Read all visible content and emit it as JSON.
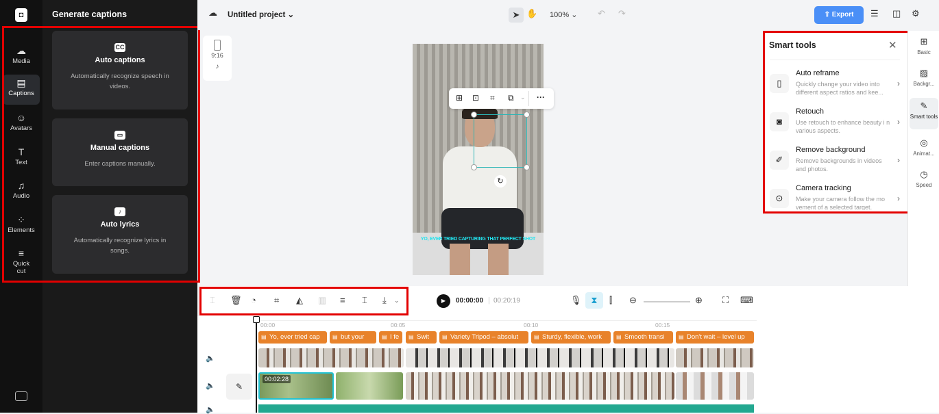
{
  "rail": {
    "items": [
      {
        "id": "media",
        "label": "Media",
        "icon": "☁"
      },
      {
        "id": "captions",
        "label": "Captions",
        "icon": "▤"
      },
      {
        "id": "avatars",
        "label": "Avatars",
        "icon": "☺"
      },
      {
        "id": "text",
        "label": "Text",
        "icon": "T"
      },
      {
        "id": "audio",
        "label": "Audio",
        "icon": "♫"
      },
      {
        "id": "elements",
        "label": "Elements",
        "icon": "⁘"
      },
      {
        "id": "quickcut",
        "label": "Quick cut",
        "icon": "≡"
      }
    ]
  },
  "panel": {
    "title": "Generate captions",
    "cards": [
      {
        "title": "Auto captions",
        "desc": "Automatically recognize speech in videos.",
        "icon": "CC"
      },
      {
        "title": "Manual captions",
        "desc": "Enter captions manually.",
        "icon": "▭"
      },
      {
        "title": "Auto lyrics",
        "desc": "Automatically recognize lyrics in songs.",
        "icon": "♪"
      }
    ]
  },
  "topbar": {
    "project": "Untitled project",
    "zoom": "100%",
    "export": "Export"
  },
  "aspect": {
    "ratio": "9:16"
  },
  "video": {
    "subtitle": "YO, EVER TRIED CAPTURING THAT PERFECT SHOT"
  },
  "smart": {
    "title": "Smart tools",
    "tools": [
      {
        "title": "Auto reframe",
        "desc": "Quickly change your video into different aspect ratios and kee..."
      },
      {
        "title": "Retouch",
        "desc": "Use retouch to enhance beauty i n various aspects."
      },
      {
        "title": "Remove background",
        "desc": "Remove backgrounds in videos and photos."
      },
      {
        "title": "Camera tracking",
        "desc": "Make your camera follow the mo vement of a selected target."
      }
    ]
  },
  "sidebar": {
    "items": [
      {
        "label": "Basic",
        "icon": "⊞"
      },
      {
        "label": "Backgr...",
        "icon": "▨"
      },
      {
        "label": "Smart tools",
        "icon": "✎"
      },
      {
        "label": "Animat...",
        "icon": "◎"
      },
      {
        "label": "Speed",
        "icon": "◷"
      }
    ]
  },
  "player": {
    "current": "00:00:00",
    "total": "00:20:19"
  },
  "timeline": {
    "ticks": [
      "00:00",
      "00:05",
      "00:10",
      "00:15"
    ],
    "captions": [
      "Yo, ever tried cap",
      "but your",
      "I fe",
      "Swit",
      "Variety Tripod – absolut",
      "Sturdy, flexible, work",
      "Smooth transi",
      "Don't wait – level up"
    ],
    "clip_time": "00:02:28"
  },
  "colors": {
    "accent": "#4a8ff7",
    "caption": "#e8822a",
    "highlight": "#e30000",
    "selection": "#2bb5b5"
  }
}
